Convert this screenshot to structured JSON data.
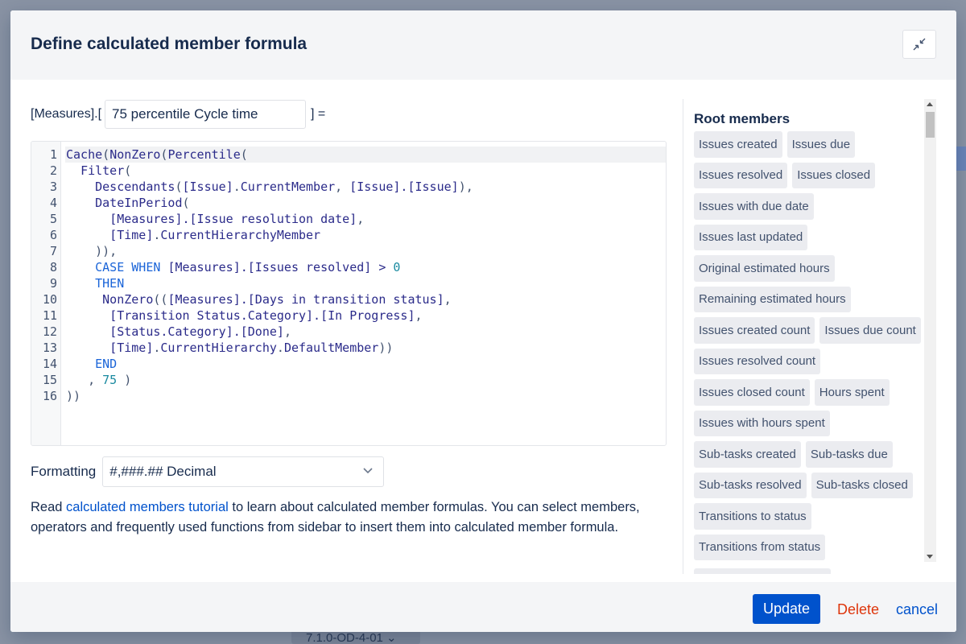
{
  "background": {
    "version_label": "7.1.0-OD-4-01"
  },
  "dialog": {
    "title": "Define calculated member formula",
    "collapse_icon": "collapse-arrows-icon"
  },
  "name": {
    "prefix": "[Measures].[",
    "value": "75 percentile Cycle time",
    "suffix": "]  ="
  },
  "editor": {
    "line_numbers": [
      "1",
      "2",
      "3",
      "4",
      "5",
      "6",
      "7",
      "8",
      "9",
      "10",
      "11",
      "12",
      "13",
      "14",
      "15",
      "16"
    ],
    "lines": [
      [
        {
          "t": "Cache",
          "c": "fn"
        },
        {
          "t": "(",
          "c": "plain"
        },
        {
          "t": "NonZero",
          "c": "fn"
        },
        {
          "t": "(",
          "c": "plain"
        },
        {
          "t": "Percentile",
          "c": "fn"
        },
        {
          "t": "(",
          "c": "plain"
        }
      ],
      [
        {
          "t": "  ",
          "c": "plain"
        },
        {
          "t": "Filter",
          "c": "fn"
        },
        {
          "t": "(",
          "c": "plain"
        }
      ],
      [
        {
          "t": "    ",
          "c": "plain"
        },
        {
          "t": "Descendants",
          "c": "fn"
        },
        {
          "t": "(",
          "c": "plain"
        },
        {
          "t": "[Issue]",
          "c": "member"
        },
        {
          "t": ".",
          "c": "plain"
        },
        {
          "t": "CurrentMember",
          "c": "fn"
        },
        {
          "t": ", ",
          "c": "plain"
        },
        {
          "t": "[Issue].[Issue]",
          "c": "member"
        },
        {
          "t": "),",
          "c": "plain"
        }
      ],
      [
        {
          "t": "    ",
          "c": "plain"
        },
        {
          "t": "DateInPeriod",
          "c": "fn"
        },
        {
          "t": "(",
          "c": "plain"
        }
      ],
      [
        {
          "t": "      ",
          "c": "plain"
        },
        {
          "t": "[Measures].[Issue resolution date]",
          "c": "member"
        },
        {
          "t": ",",
          "c": "plain"
        }
      ],
      [
        {
          "t": "      ",
          "c": "plain"
        },
        {
          "t": "[Time]",
          "c": "member"
        },
        {
          "t": ".",
          "c": "plain"
        },
        {
          "t": "CurrentHierarchyMember",
          "c": "fn"
        }
      ],
      [
        {
          "t": "    )),",
          "c": "plain"
        }
      ],
      [
        {
          "t": "    ",
          "c": "plain"
        },
        {
          "t": "CASE WHEN",
          "c": "kw"
        },
        {
          "t": " ",
          "c": "plain"
        },
        {
          "t": "[Measures].[Issues resolved]",
          "c": "member"
        },
        {
          "t": " > ",
          "c": "op"
        },
        {
          "t": "0",
          "c": "num"
        }
      ],
      [
        {
          "t": "    ",
          "c": "plain"
        },
        {
          "t": "THEN",
          "c": "kw"
        }
      ],
      [
        {
          "t": "     ",
          "c": "plain"
        },
        {
          "t": "NonZero",
          "c": "fn"
        },
        {
          "t": "((",
          "c": "plain"
        },
        {
          "t": "[Measures].[Days in transition status]",
          "c": "member"
        },
        {
          "t": ",",
          "c": "plain"
        }
      ],
      [
        {
          "t": "      ",
          "c": "plain"
        },
        {
          "t": "[Transition Status.Category].[In Progress]",
          "c": "member"
        },
        {
          "t": ",",
          "c": "plain"
        }
      ],
      [
        {
          "t": "      ",
          "c": "plain"
        },
        {
          "t": "[Status.Category].[Done]",
          "c": "member"
        },
        {
          "t": ",",
          "c": "plain"
        }
      ],
      [
        {
          "t": "      ",
          "c": "plain"
        },
        {
          "t": "[Time]",
          "c": "member"
        },
        {
          "t": ".",
          "c": "plain"
        },
        {
          "t": "CurrentHierarchy",
          "c": "fn"
        },
        {
          "t": ".",
          "c": "plain"
        },
        {
          "t": "DefaultMember",
          "c": "fn"
        },
        {
          "t": "))",
          "c": "plain"
        }
      ],
      [
        {
          "t": "    ",
          "c": "plain"
        },
        {
          "t": "END",
          "c": "kw"
        }
      ],
      [
        {
          "t": "   , ",
          "c": "plain"
        },
        {
          "t": "75",
          "c": "num"
        },
        {
          "t": " )",
          "c": "plain"
        }
      ],
      [
        {
          "t": "))",
          "c": "plain"
        }
      ]
    ]
  },
  "formatting": {
    "label": "Formatting",
    "selected": "#,###.## Decimal",
    "chevron_icon": "chevron-down-icon"
  },
  "help": {
    "prefix": "Read ",
    "link": "calculated members tutorial",
    "suffix": " to learn about calculated member formulas. You can select members, operators and frequently used functions from sidebar to insert them into calculated member formula."
  },
  "sidebar": {
    "title": "Root members",
    "items": [
      "Issues created",
      "Issues due",
      "Issues resolved",
      "Issues closed",
      "Issues with due date",
      "Issues last updated",
      "Original estimated hours",
      "Remaining estimated hours",
      "Issues created count",
      "Issues due count",
      "Issues resolved count",
      "Issues closed count",
      "Hours spent",
      "Issues with hours spent",
      "Sub-tasks created",
      "Sub-tasks due",
      "Sub-tasks resolved",
      "Sub-tasks closed",
      "Transitions to status",
      "Transitions from status"
    ]
  },
  "footer": {
    "update": "Update",
    "delete": "Delete",
    "cancel": "cancel"
  },
  "colors": {
    "primary": "#0052cc",
    "danger": "#de350b",
    "function": "#2b2b8a",
    "keyword": "#1a64d8",
    "number": "#1a8aa0"
  }
}
